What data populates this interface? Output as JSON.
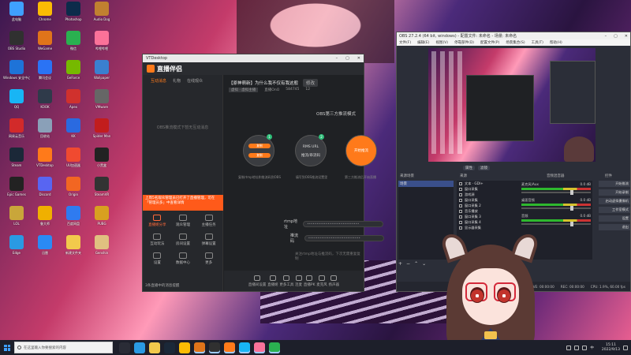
{
  "desktop": {
    "icons": [
      {
        "label": "此电脑",
        "color": "#3fa0ff"
      },
      {
        "label": "OBS Studio",
        "color": "#303030"
      },
      {
        "label": "Windows 安全中心",
        "color": "#1e73d8"
      },
      {
        "label": "QQ",
        "color": "#18b5f5"
      },
      {
        "label": "网易云音乐",
        "color": "#d22a2a"
      },
      {
        "label": "Steam",
        "color": "#1b2838"
      },
      {
        "label": "Epic Games",
        "color": "#222"
      },
      {
        "label": "LOL",
        "color": "#c9a63a"
      },
      {
        "label": "Edge",
        "color": "#2a9ae3"
      },
      {
        "label": "Chrome",
        "color": "#fbbc04"
      },
      {
        "label": "WeGame",
        "color": "#e0741a"
      },
      {
        "label": "腾讯会议",
        "color": "#2a73f5"
      },
      {
        "label": "KOOK",
        "color": "#2f3a4a"
      },
      {
        "label": "回收站",
        "color": "#8aa0b8"
      },
      {
        "label": "VTDesktop",
        "color": "#ff7a1a"
      },
      {
        "label": "Discord",
        "color": "#5865f2"
      },
      {
        "label": "鲁大师",
        "color": "#f0b000"
      },
      {
        "label": "迅雷",
        "color": "#2a8af5"
      },
      {
        "label": "Photoshop",
        "color": "#0c2b4a"
      },
      {
        "label": "微信",
        "color": "#2ab150"
      },
      {
        "label": "GeForce",
        "color": "#76b900"
      },
      {
        "label": "Apex",
        "color": "#d0312d"
      },
      {
        "label": "KK",
        "color": "#2a6ae0"
      },
      {
        "label": "UU加速器",
        "color": "#f04a30"
      },
      {
        "label": "Origin",
        "color": "#f26622"
      },
      {
        "label": "百度网盘",
        "color": "#2f7bf0"
      },
      {
        "label": "新建文件夹",
        "color": "#f2c94c"
      },
      {
        "label": "Audio Dog",
        "color": "#c08030"
      },
      {
        "label": "哔哩哔哩",
        "color": "#fb7299"
      },
      {
        "label": "Wallpaper",
        "color": "#3a80d0"
      },
      {
        "label": "VMware",
        "color": "#666"
      },
      {
        "label": "Spider Man",
        "color": "#c21d1d"
      },
      {
        "label": "小黑盒",
        "color": "#222"
      },
      {
        "label": "SteamVR",
        "color": "#333"
      },
      {
        "label": "PUBG",
        "color": "#d8a020"
      },
      {
        "label": "Genshin",
        "color": "#e0c080"
      }
    ]
  },
  "vt": {
    "window_title": "VTDesktop",
    "app_name": "直播伴侣",
    "side_tabs": [
      "互动消息",
      "礼物",
      "在线观众"
    ],
    "empty_note": "OBS推流模式下暂无互动消息",
    "notice": "上周5名观众管理员已打开了直播管理，可在「管理员多」中查看详情",
    "tools": [
      {
        "label": "直播姬分享",
        "hot": true
      },
      {
        "label": "观众管理",
        "hot": false
      },
      {
        "label": "主播任务",
        "hot": false
      },
      {
        "label": "互动玩法",
        "hot": false
      },
      {
        "label": "房间设置",
        "hot": false
      },
      {
        "label": "弹幕设置",
        "hot": false
      },
      {
        "label": "设置",
        "hot": false
      },
      {
        "label": "数据中心",
        "hot": false
      },
      {
        "label": "更多",
        "hot": false
      }
    ],
    "footer": "3条直播中的消息提醒",
    "room_title": "【原神萌新】为什么我不仅有我这般",
    "room_chip": "修改",
    "room_meta": [
      "虚拟 · 虚拟主播",
      "直播OnO",
      "584745",
      "12"
    ],
    "obs_mode": "OBS第三方推流模式",
    "nodes": [
      {
        "pill1": "复制",
        "pill2": "复制",
        "num": "1",
        "cap": "复制rtmp地址和推流码到OBS"
      },
      {
        "text1": "RMS URL",
        "text2": "推流/串流码",
        "num": "2",
        "cap": "填写到OBS推流设置里"
      },
      {
        "text1": "开始推流",
        "cap": "第三方推流后开始直播"
      }
    ],
    "rtmp_label": "rtmp地址",
    "rtmp_value": "••••••••••••••••••••••••••••",
    "key_label": "推流码",
    "key_value": "••••••••••••••••••••••••••••",
    "hint": "关注rtmp地址与推流码，下次无需重复复制",
    "toolbar": [
      "直播间设置",
      "直播姬",
      "更多工具",
      "连麦",
      "直播PK",
      "麦克风",
      "扬声器"
    ]
  },
  "obs": {
    "window_title": "OBS 27.2.4 (64 bit, windows) - 配置文件: 未命名 - 场景: 未命名",
    "menu": [
      "文件(F)",
      "编辑(E)",
      "视图(V)",
      "停靠部件(D)",
      "配置文件(P)",
      "场景集合(S)",
      "工具(T)",
      "帮助(H)"
    ],
    "preview_bar": [
      "属性",
      "滤镜"
    ],
    "panels": {
      "scenes": "来源场景",
      "sources": "来源",
      "mixer": "音频混音器",
      "controls": "控件"
    },
    "scene_items": [
      "场景"
    ],
    "sources": [
      "文本 · GDI+",
      "窗口采集",
      "游戏源",
      "窗口采集",
      "窗口采集 2",
      "音乐播放",
      "窗口采集 3",
      "窗口采集 4",
      "显示器采集"
    ],
    "mixer": [
      {
        "name": "麦克风/Aux",
        "db": "0.0 dB"
      },
      {
        "name": "桌面音频",
        "db": "0.0 dB"
      },
      {
        "name": "音频",
        "db": "0.0 dB"
      }
    ],
    "controls": [
      "开始推流",
      "开始录制",
      "启动虚拟摄像机",
      "工作室模式",
      "设置",
      "退出"
    ],
    "status": [
      "LIVE: 00:00:00",
      "REC: 00:00:00",
      "CPU: 1.9%, 60.00 fps"
    ],
    "add_buttons": [
      "+",
      "−",
      "⌃",
      "⌄"
    ]
  },
  "taskbar": {
    "search_placeholder": "在这里输入你要搜索的内容",
    "apps": [
      {
        "name": "task-view",
        "color": "#2a2c36"
      },
      {
        "name": "edge",
        "color": "#2a9ae3"
      },
      {
        "name": "file-explorer",
        "color": "#f2c94c"
      },
      {
        "name": "steam",
        "color": "#1b2838"
      },
      {
        "name": "chrome",
        "color": "#fbbc04"
      },
      {
        "name": "wegame",
        "color": "#e0741a"
      },
      {
        "name": "obs",
        "color": "#303030"
      },
      {
        "name": "vtdesktop",
        "color": "#ff7a1a"
      },
      {
        "name": "qq",
        "color": "#18b5f5"
      },
      {
        "name": "bilibili",
        "color": "#fb7299"
      },
      {
        "name": "wechat",
        "color": "#2ab150"
      }
    ],
    "time": "15:11",
    "date": "2022/9/13",
    "lang": "中"
  }
}
